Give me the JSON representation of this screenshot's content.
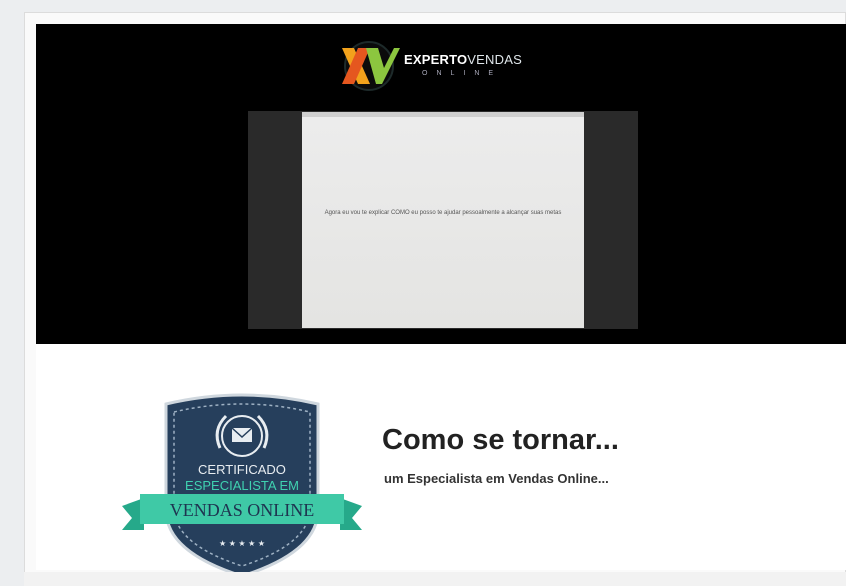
{
  "logo": {
    "word_bold": "EXPERTO",
    "word_light": "VENDAS",
    "subline": "ONLINE"
  },
  "video": {
    "slide_text": "Agora eu vou te explicar COMO eu posso te ajudar pessoalmente a alcançar suas metas"
  },
  "badge": {
    "line1": "CERTIFICADO",
    "line2": "ESPECIALISTA EM",
    "ribbon": "VENDAS ONLINE",
    "stars": "★ ★ ★ ★ ★"
  },
  "promo": {
    "title": "Como se tornar...",
    "subtitle": "um Especialista em Vendas Online..."
  }
}
